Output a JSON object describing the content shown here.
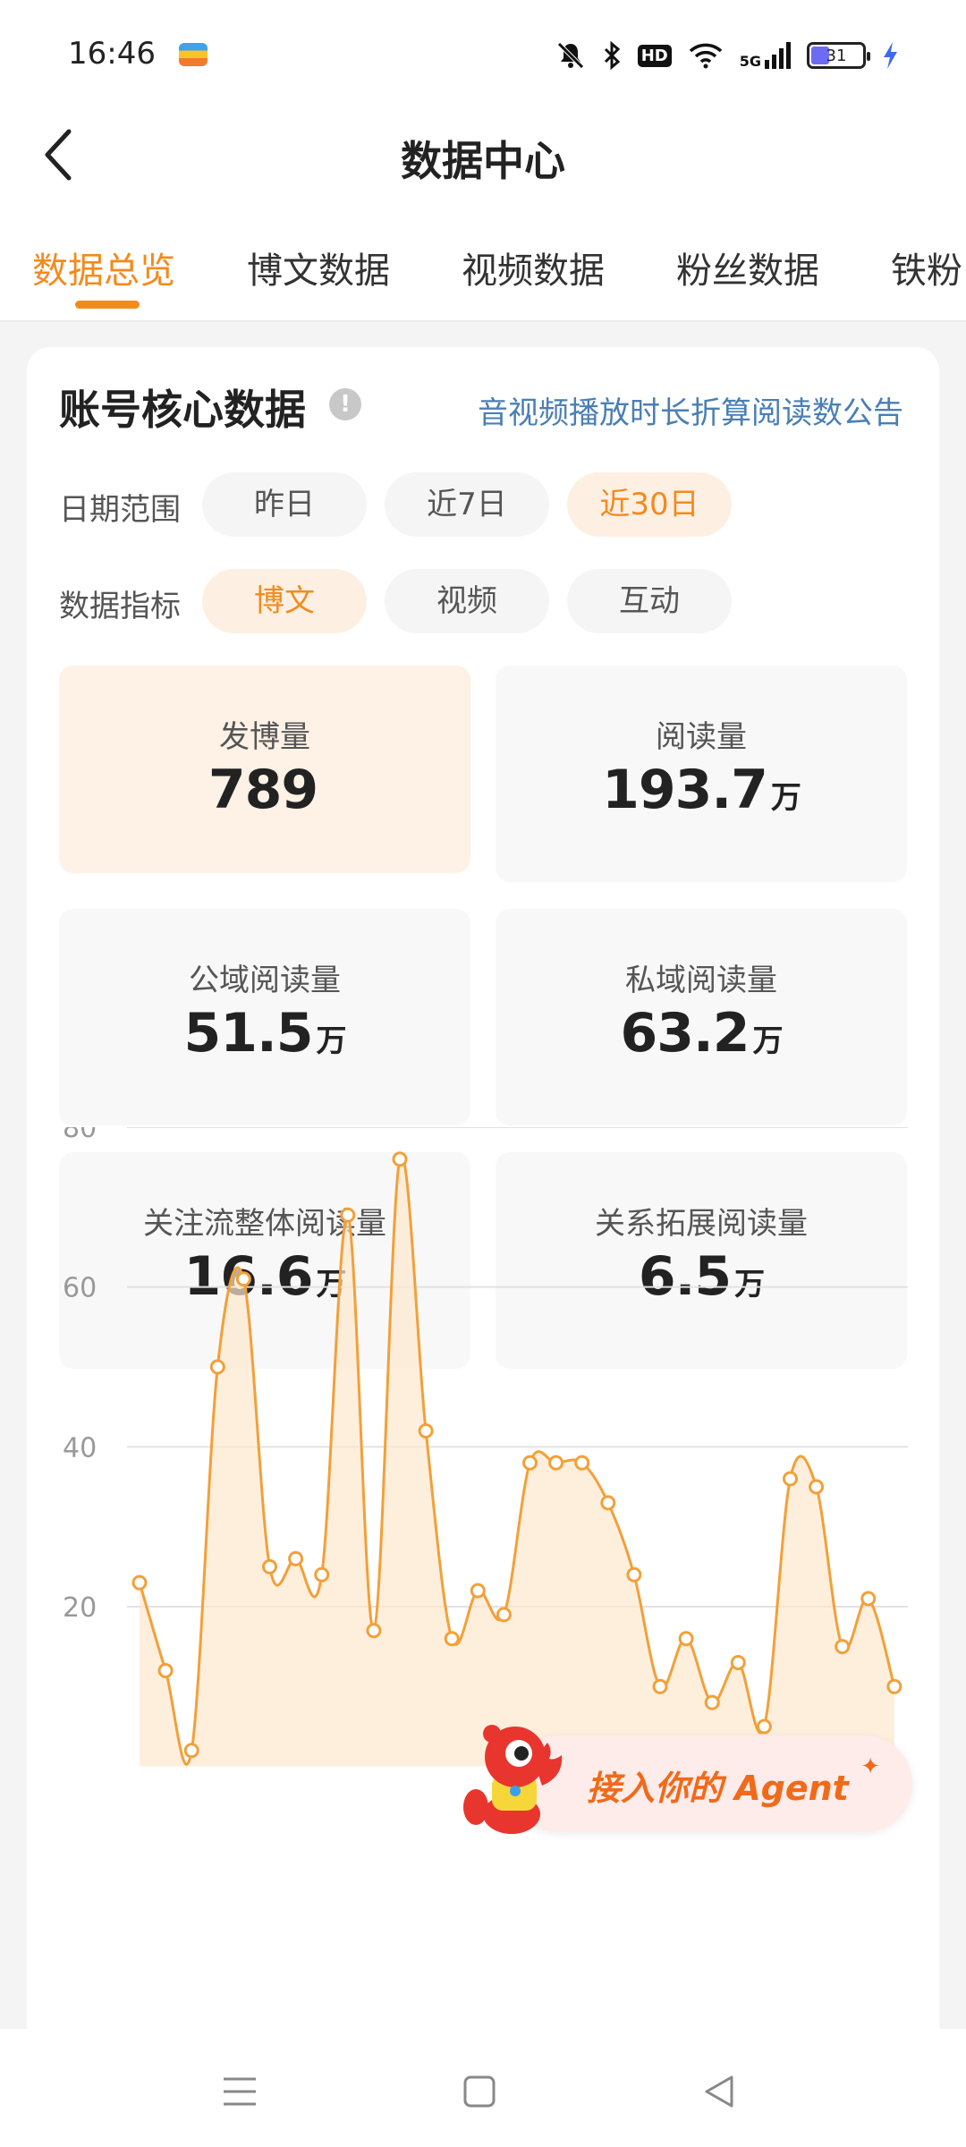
{
  "status_bar": {
    "time": "16:46",
    "hd": "HD",
    "network": "5G",
    "battery": "31",
    "icons": [
      "app-notification-icon",
      "mute-bell-icon",
      "bluetooth-icon",
      "hd-icon",
      "wifi-icon",
      "signal-icon",
      "battery-icon",
      "charging-icon"
    ]
  },
  "header": {
    "title": "数据中心",
    "back_icon": "chevron-left-icon"
  },
  "tabs": [
    {
      "label": "数据总览",
      "active": true
    },
    {
      "label": "博文数据",
      "active": false
    },
    {
      "label": "视频数据",
      "active": false
    },
    {
      "label": "粉丝数据",
      "active": false
    },
    {
      "label": "铁粉",
      "active": false
    }
  ],
  "card": {
    "title": "账号核心数据",
    "info_icon": "!",
    "notice_link": "音视频播放时长折算阅读数公告",
    "date_range": {
      "label": "日期范围",
      "options": [
        "昨日",
        "近7日",
        "近30日"
      ],
      "selected": "近30日"
    },
    "metric_type": {
      "label": "数据指标",
      "options": [
        "博文",
        "视频",
        "互动"
      ],
      "selected": "博文"
    },
    "metrics": [
      {
        "label": "发博量",
        "value": "789",
        "unit": "",
        "active": true
      },
      {
        "label": "阅读量",
        "value": "193.7",
        "unit": "万",
        "active": false
      },
      {
        "label": "公域阅读量",
        "value": "51.5",
        "unit": "万",
        "active": false
      },
      {
        "label": "私域阅读量",
        "value": "63.2",
        "unit": "万",
        "active": false
      },
      {
        "label": "关注流整体阅读量",
        "value": "16.6",
        "unit": "万",
        "active": false
      },
      {
        "label": "关系拓展阅读量",
        "value": "6.5",
        "unit": "万",
        "active": false
      }
    ]
  },
  "chart_data": {
    "type": "area",
    "title": "",
    "xlabel": "",
    "ylabel": "",
    "yticks": [
      "80",
      "60",
      "40",
      "20"
    ],
    "ylim": [
      0,
      80
    ],
    "grid": true,
    "legend": "none",
    "line_color": "#f2a03a",
    "fill_color": "#fde8cf",
    "y": [
      23,
      12,
      2,
      50,
      61,
      25,
      26,
      24,
      69,
      17,
      76,
      42,
      16,
      22,
      19,
      38,
      38,
      38,
      33,
      24,
      10,
      16,
      8,
      13,
      5,
      36,
      35,
      15,
      21,
      10
    ]
  },
  "agent_badge": {
    "text": "接入你的 Agent",
    "spark": "✦"
  },
  "nav_bar": {
    "icons": [
      "menu-icon",
      "home-square-icon",
      "back-triangle-icon"
    ]
  }
}
